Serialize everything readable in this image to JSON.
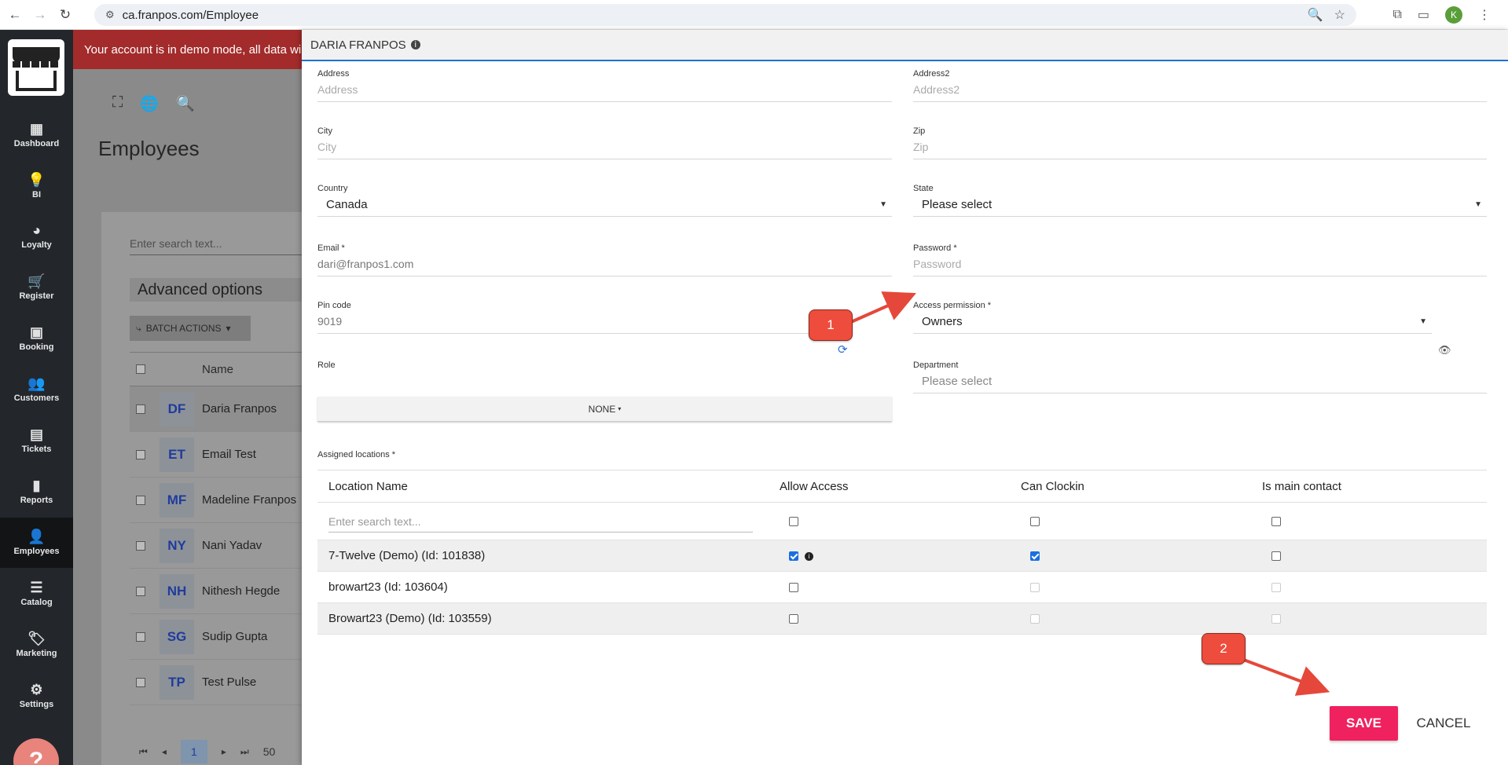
{
  "browser": {
    "url": "ca.franpos.com/Employee",
    "profile_initial": "K"
  },
  "sidebar": {
    "items": [
      {
        "label": "Dashboard",
        "icon": "dashboard-icon",
        "glyph": "▦"
      },
      {
        "label": "BI",
        "icon": "lightbulb-icon",
        "glyph": "💡"
      },
      {
        "label": "Loyalty",
        "icon": "pie-icon",
        "glyph": "◕"
      },
      {
        "label": "Register",
        "icon": "cart-icon",
        "glyph": "🛒"
      },
      {
        "label": "Booking",
        "icon": "calendar-icon",
        "glyph": "▣"
      },
      {
        "label": "Customers",
        "icon": "people-icon",
        "glyph": "👥"
      },
      {
        "label": "Tickets",
        "icon": "ticket-icon",
        "glyph": "▤"
      },
      {
        "label": "Reports",
        "icon": "bar-chart-icon",
        "glyph": "▮"
      },
      {
        "label": "Employees",
        "icon": "person-icon",
        "glyph": "👤"
      },
      {
        "label": "Catalog",
        "icon": "list-icon",
        "glyph": "☰"
      },
      {
        "label": "Marketing",
        "icon": "tag-icon",
        "glyph": "🏷"
      },
      {
        "label": "Settings",
        "icon": "gear-icon",
        "glyph": "⚙"
      }
    ],
    "help": "?"
  },
  "background": {
    "demo_banner": "Your account is in demo mode, all data will",
    "page_title": "Employees",
    "search_placeholder": "Enter search text...",
    "advanced_options": "Advanced options",
    "batch_actions": "BATCH ACTIONS",
    "name_header": "Name",
    "employees": [
      {
        "initials": "DF",
        "name": "Daria Franpos"
      },
      {
        "initials": "ET",
        "name": "Email Test"
      },
      {
        "initials": "MF",
        "name": "Madeline Franpos"
      },
      {
        "initials": "NY",
        "name": "Nani Yadav"
      },
      {
        "initials": "NH",
        "name": "Nithesh Hegde"
      },
      {
        "initials": "SG",
        "name": "Sudip Gupta"
      },
      {
        "initials": "TP",
        "name": "Test Pulse"
      }
    ],
    "current_page": "1",
    "page_size": "50"
  },
  "drawer": {
    "title": "DARIA FRANPOS",
    "address": {
      "label": "Address",
      "placeholder": "Address"
    },
    "address2": {
      "label": "Address2",
      "placeholder": "Address2"
    },
    "city": {
      "label": "City",
      "placeholder": "City"
    },
    "zip": {
      "label": "Zip",
      "placeholder": "Zip"
    },
    "country": {
      "label": "Country",
      "value": "Canada"
    },
    "state": {
      "label": "State",
      "value": "Please select"
    },
    "email": {
      "label": "Email *",
      "value": "dari@franpos1.com"
    },
    "password": {
      "label": "Password *",
      "placeholder": "Password"
    },
    "pin": {
      "label": "Pin code",
      "value": "9019"
    },
    "access": {
      "label": "Access permission *",
      "value": "Owners"
    },
    "role": {
      "label": "Role",
      "value": "NONE"
    },
    "department": {
      "label": "Department",
      "value": "Please select"
    },
    "locations_label": "Assigned locations *",
    "locations": {
      "headers": [
        "Location Name",
        "Allow Access",
        "Can Clockin",
        "Is main contact"
      ],
      "search_placeholder": "Enter search text...",
      "rows": [
        {
          "name": "7-Twelve (Demo) (Id: 101838)",
          "allow": true,
          "clockin": true,
          "main": false,
          "info": true
        },
        {
          "name": "browart23 (Id: 103604)",
          "allow": false,
          "clockin": false,
          "main": false,
          "info": false
        },
        {
          "name": "Browart23 (Demo) (Id: 103559)",
          "allow": false,
          "clockin": false,
          "main": false,
          "info": false
        }
      ]
    },
    "save": "SAVE",
    "cancel": "CANCEL"
  },
  "annotations": {
    "badge1": "1",
    "badge2": "2",
    "arrow_color": "#e5483a"
  },
  "colors": {
    "accent": "#1f6fd6",
    "save": "#f0215f",
    "sidebar": "#23272c"
  }
}
